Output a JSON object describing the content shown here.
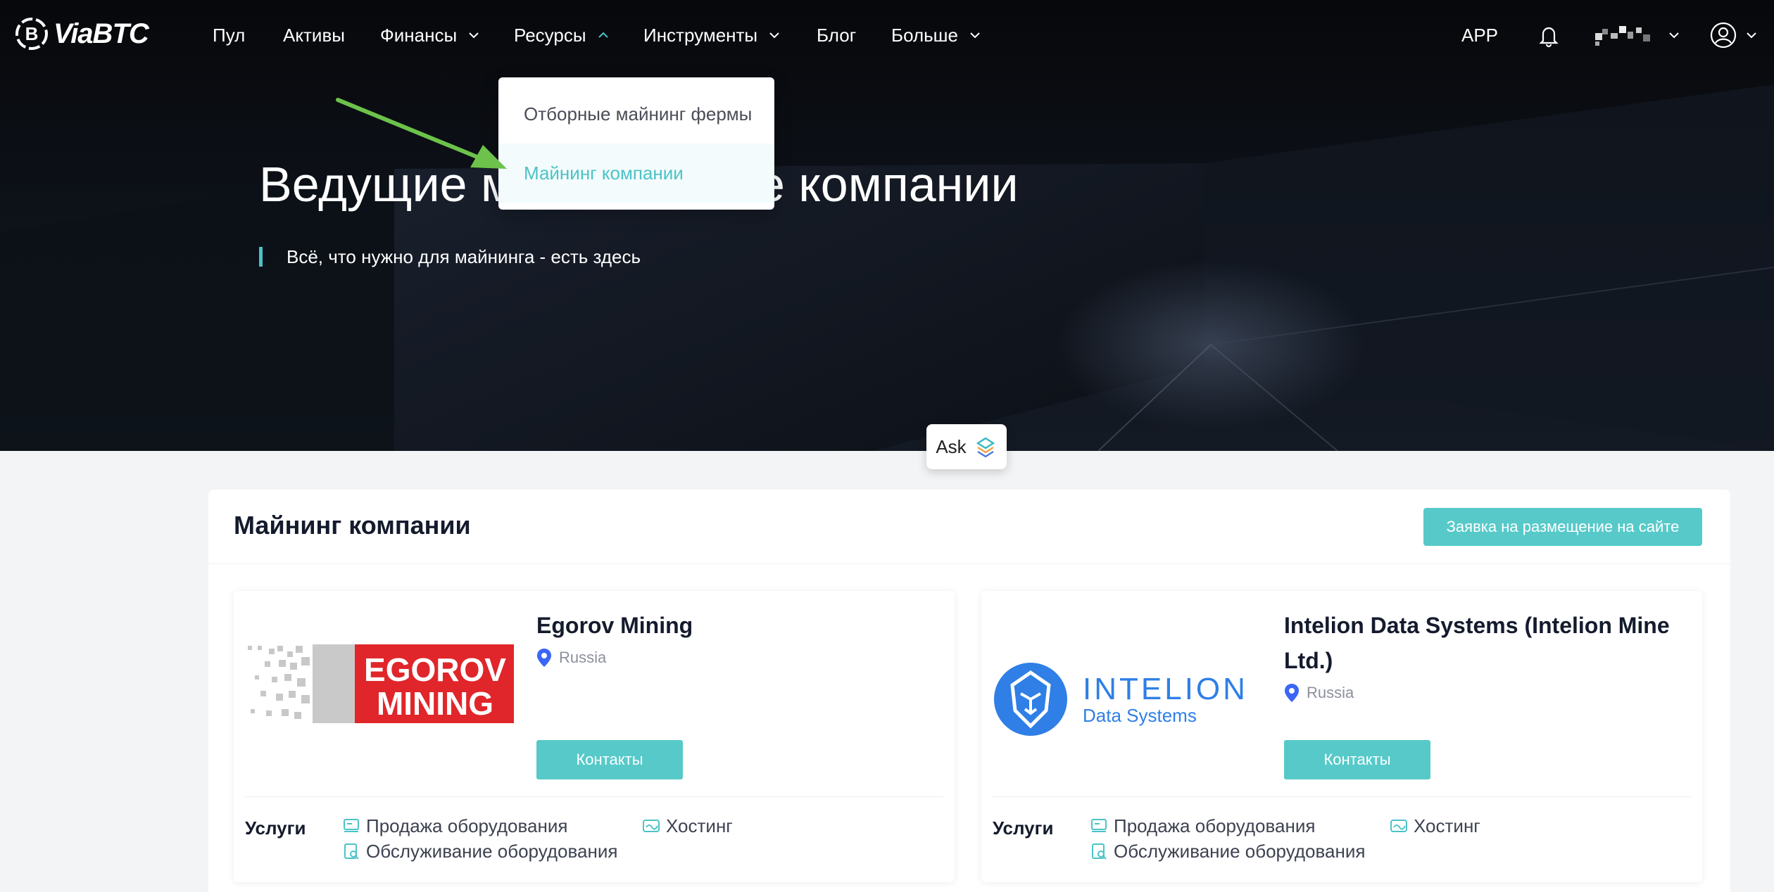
{
  "brand": {
    "name": "ViaBTC"
  },
  "nav": {
    "items": [
      {
        "label": "Пул"
      },
      {
        "label": "Активы"
      },
      {
        "label": "Финансы"
      },
      {
        "label": "Ресурсы"
      },
      {
        "label": "Инструменты"
      },
      {
        "label": "Блог"
      },
      {
        "label": "Больше"
      }
    ],
    "app_label": "APP"
  },
  "dropdown": {
    "items": [
      {
        "label": "Отборные майнинг фермы"
      },
      {
        "label": "Майнинг компании"
      }
    ]
  },
  "hero": {
    "title": "Ведущие майнинговые компании",
    "subtitle": "Всё, что нужно для майнинга - есть здесь"
  },
  "ask": {
    "label": "Ask"
  },
  "section": {
    "title": "Майнинг компании",
    "apply_label": "Заявка на размещение на сайте"
  },
  "companies": [
    {
      "name": "Egorov Mining",
      "logo_line1": "EGOROV",
      "logo_line2": "MINING",
      "location": "Russia",
      "contact_label": "Контакты",
      "services_label": "Услуги",
      "services": [
        "Продажа оборудования",
        "Хостинг",
        "Обслуживание оборудования"
      ]
    },
    {
      "name": "Intelion Data Systems (Intelion Mine Ltd.)",
      "logo_line1": "INTELION",
      "logo_line2": "Data Systems",
      "location": "Russia",
      "contact_label": "Контакты",
      "services_label": "Услуги",
      "services": [
        "Продажа оборудования",
        "Хостинг",
        "Обслуживание оборудования"
      ]
    }
  ],
  "colors": {
    "accent": "#57c9c9",
    "accent_text": "#4cc3c6",
    "egorov_red": "#e0262a",
    "intelion_blue": "#2f7fe6",
    "pin_blue": "#3b66f5"
  }
}
